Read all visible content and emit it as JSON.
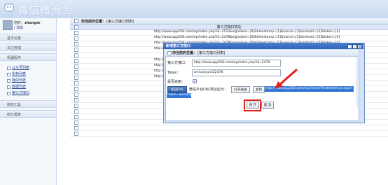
{
  "app": {
    "brand_title": "微信微商务"
  },
  "sidebar": {
    "user_label": "您好，",
    "username": "zhanger",
    "logout": "退出",
    "sections": [
      {
        "label": "基本设置"
      },
      {
        "label": "关注管理"
      },
      {
        "label": "机器服务"
      },
      {
        "label": "微信工具"
      },
      {
        "label": "统计报表"
      }
    ],
    "items": [
      {
        "label": "公众号列表"
      },
      {
        "label": "机构列表"
      },
      {
        "label": "我的列表"
      },
      {
        "label": "数据列表"
      },
      {
        "label": "第三方接口"
      }
    ]
  },
  "main": {
    "location_label": "你当前的位置：",
    "location_path": "[第三方接口列表]",
    "column_header": "第三方接口地址",
    "rows": [
      "http://www.app258.com/mp/index.php?id=5522&signature=[0]&timestamp=[1]&nonce=[2]&echostr=[3]&token=[4]",
      "http://www.app258.com/mp/index.php?id=2478&signature=[0]&timestamp=[1]&nonce=[2]&echostr=[3]&token=[4]",
      "http://www.app258.com/mp/index.php?id=2478&signature=[0]&timestamp=[1]&nonce=[2]&echostr=[3]&token=[4]",
      "http://www.app258.com/mp/index.php?id=2478&signature=[0]&timestamp=[1]&nonce=[2]&echostr=[3]&token=[4]",
      "",
      "http://",
      "http://",
      "http://",
      "http://"
    ]
  },
  "dialog": {
    "title": "新增第三方接口",
    "location_label": "你当前的位置：",
    "location_path": "[第三方接口列表]",
    "interface_label": "第三方接口：",
    "interface_value": "http://www.app258.com/mp/index.php?id=2478",
    "token_label": "Token：",
    "token_value": "weisanyun322478",
    "enable_label": "是否启用：",
    "gen_button": "生成URL",
    "gen_desc": "微信平台URL地址应为：",
    "open_button": "打开链接",
    "copy_button": "复制",
    "url_value": "http://www.app258.com/mp/CheckThirdInterface.aspx?",
    "url_value2": "token=weisanyun322478",
    "save_button": "保 存",
    "cancel_button": "取 消"
  },
  "colors": {
    "accent": "#2f63b8",
    "highlight": "#e0201a",
    "selection": "#3377d6"
  }
}
